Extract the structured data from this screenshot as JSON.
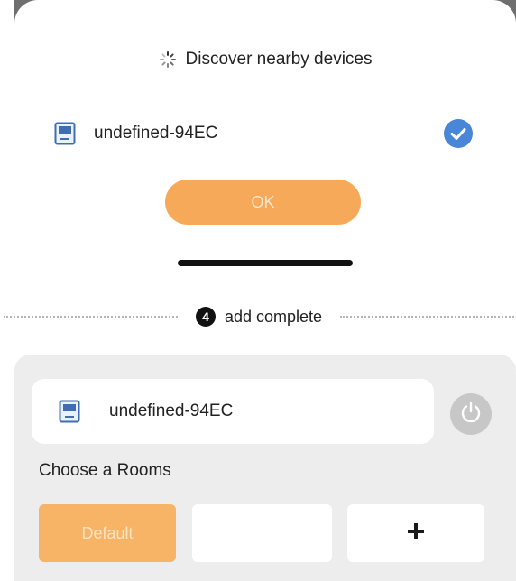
{
  "discover": {
    "title": "Discover nearby devices",
    "device_name": "undefined-94EC",
    "ok_label": "OK"
  },
  "step": {
    "number": "4",
    "label": "add complete"
  },
  "panel": {
    "device_name": "undefined-94EC",
    "rooms_title": "Choose a Rooms",
    "rooms": [
      {
        "label": "Default",
        "selected": true
      },
      {
        "label": "",
        "selected": false
      }
    ],
    "add_symbol": "+"
  },
  "colors": {
    "accent": "#f7a95a",
    "check_blue": "#4a86d8",
    "panel_bg": "#ededed"
  },
  "icons": [
    "spinner-icon",
    "device-icon",
    "checkmark-icon",
    "power-icon",
    "plus-icon"
  ]
}
